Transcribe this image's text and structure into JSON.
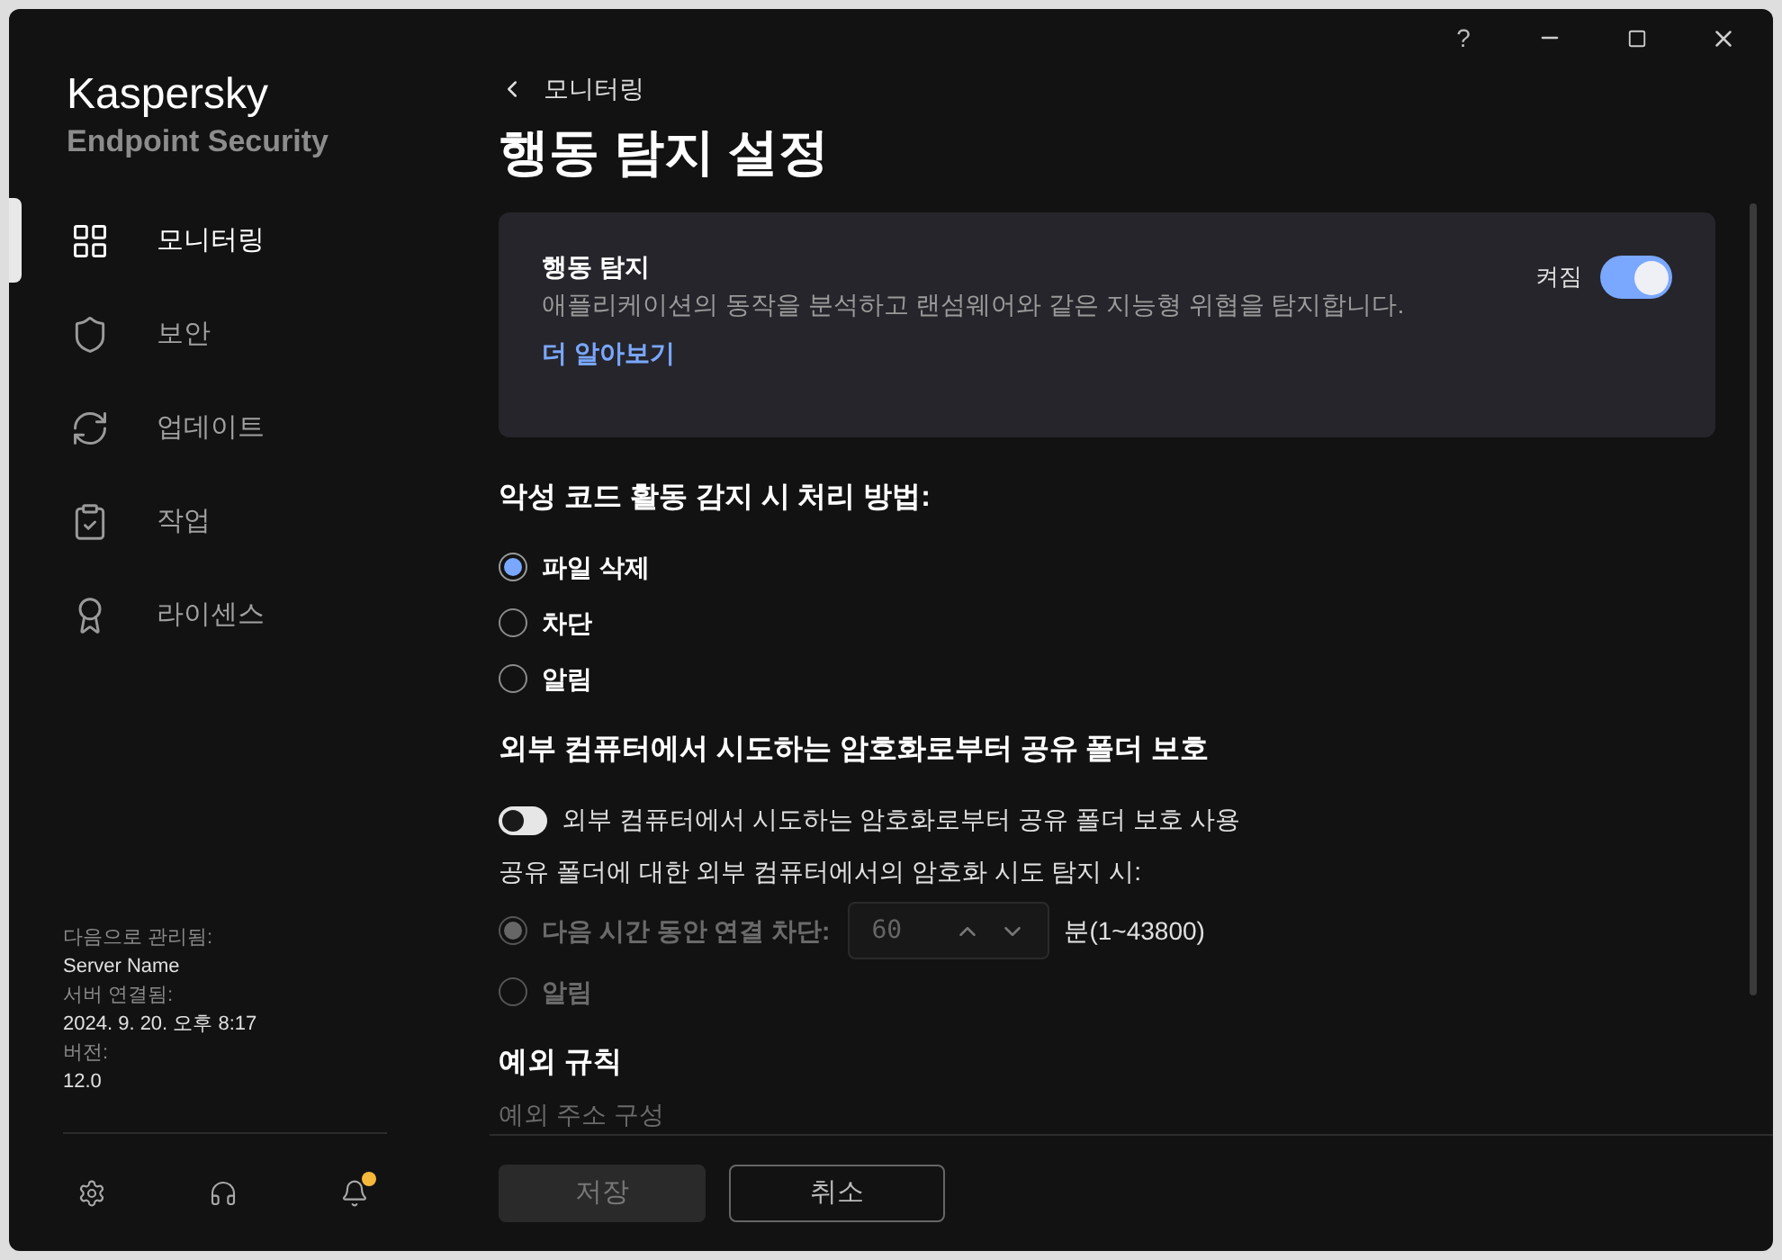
{
  "app": {
    "brand": "Kaspersky",
    "product": "Endpoint Security"
  },
  "nav": [
    {
      "label": "모니터링",
      "selected": true
    },
    {
      "label": "보안",
      "selected": false
    },
    {
      "label": "업데이트",
      "selected": false
    },
    {
      "label": "작업",
      "selected": false
    },
    {
      "label": "라이센스",
      "selected": false
    }
  ],
  "managed_info": [
    {
      "label": "다음으로 관리됨:",
      "value": "Server Name"
    },
    {
      "label": "서버 연결됨:",
      "value": "2024. 9. 20. 오후 8:17"
    },
    {
      "label": "버전:",
      "value": "12.0"
    }
  ],
  "sidebar_footer": [
    {
      "badge": false
    },
    {
      "badge": false
    },
    {
      "badge": true
    }
  ],
  "title_bar": {
    "help": "?"
  },
  "back_link": "모니터링",
  "title": "행동 탐지 설정",
  "feature_card": {
    "title": "행동 탐지",
    "description": "애플리케이션의 동작을 분석하고 랜섬웨어와 같은 지능형 위협을 탐지합니다.",
    "link": "더 알아보기",
    "toggle_label": "켜짐",
    "on": true
  },
  "action_section": {
    "heading": "악성 코드 활동 감지 시 처리 방법:",
    "options": [
      {
        "label": "파일 삭제",
        "selected": true,
        "disabled": false
      },
      {
        "label": "차단",
        "selected": false,
        "disabled": false
      },
      {
        "label": "알림",
        "selected": false,
        "disabled": false
      }
    ]
  },
  "share_section": {
    "heading": "외부 컴퓨터에서 시도하는 암호화로부터 공유 폴더 보호",
    "toggle": {
      "label": "외부 컴퓨터에서 시도하는 암호화로부터 공유 폴더 보호 사용",
      "on": false
    },
    "subheading": "공유 폴더에 대한 외부 컴퓨터에서의 암호화 시도 탐지 시:",
    "options": [
      {
        "kind": "spinner",
        "label": "다음 시간 동안 연결 차단:",
        "selected": true,
        "disabled": true,
        "value": "60",
        "unit": "분(1~43800)"
      },
      {
        "kind": "plain",
        "label": "알림",
        "selected": false,
        "disabled": true
      }
    ]
  },
  "exclusions": {
    "heading": "예외 규칙",
    "link": "예외 주소 구성"
  },
  "buttons": [
    {
      "label": "저장",
      "kind": "primary",
      "disabled": true
    },
    {
      "label": "취소",
      "kind": "secondary",
      "disabled": false
    }
  ]
}
